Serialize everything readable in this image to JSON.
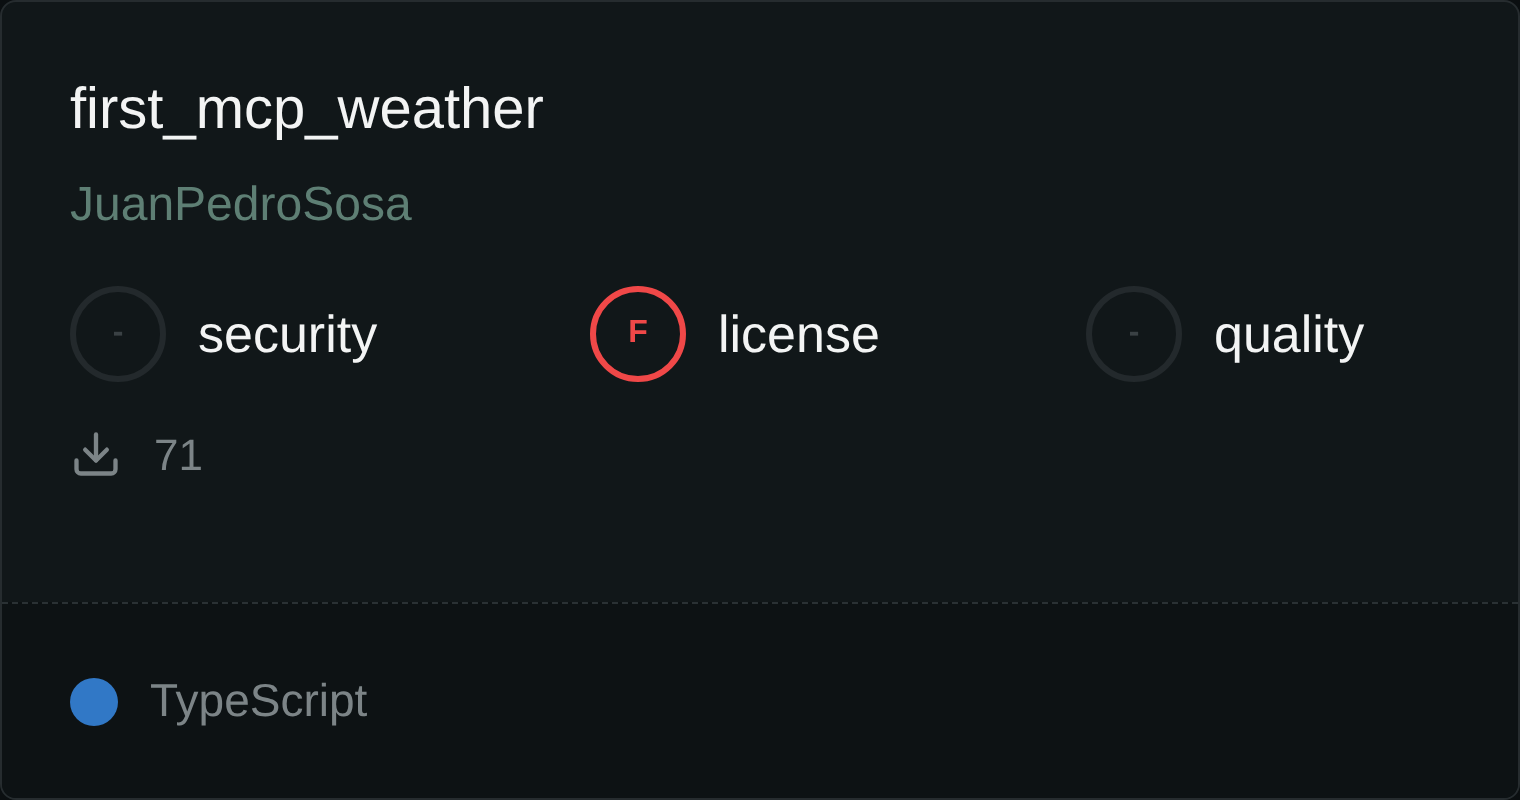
{
  "title": "first_mcp_weather",
  "author": "JuanPedroSosa",
  "scores": [
    {
      "grade": "-",
      "label": "security",
      "color": "#23292c"
    },
    {
      "grade": "F",
      "label": "license",
      "color": "#f04848"
    },
    {
      "grade": "-",
      "label": "quality",
      "color": "#23292c"
    }
  ],
  "downloads": "71",
  "language": {
    "name": "TypeScript",
    "color": "#3178c6"
  }
}
